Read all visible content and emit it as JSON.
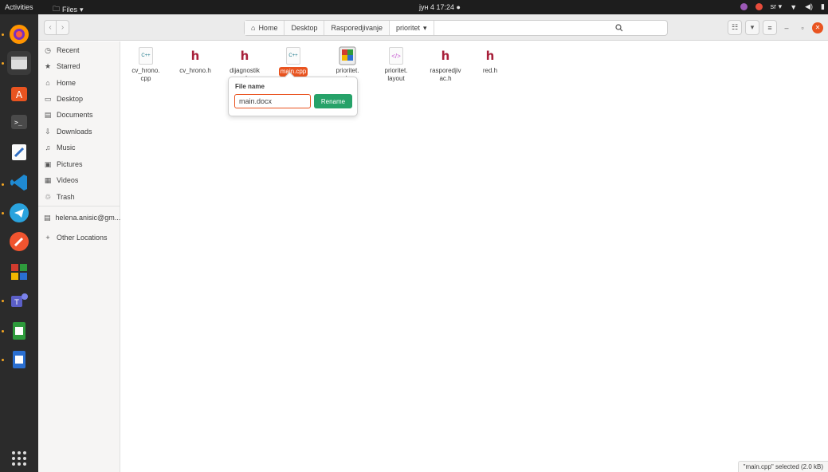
{
  "topbar": {
    "activities": "Activities",
    "app_name": "Files",
    "clock": "јун 4  17:24",
    "lang": "sr"
  },
  "header": {
    "breadcrumbs": [
      "Home",
      "Desktop",
      "Rasporedjivanje",
      "prioritet"
    ]
  },
  "sidebar": {
    "items": [
      {
        "label": "Recent",
        "icon": "clock-icon"
      },
      {
        "label": "Starred",
        "icon": "star-icon"
      },
      {
        "label": "Home",
        "icon": "home-icon"
      },
      {
        "label": "Desktop",
        "icon": "desktop-icon"
      },
      {
        "label": "Documents",
        "icon": "documents-icon"
      },
      {
        "label": "Downloads",
        "icon": "download-icon"
      },
      {
        "label": "Music",
        "icon": "music-icon"
      },
      {
        "label": "Pictures",
        "icon": "pictures-icon"
      },
      {
        "label": "Videos",
        "icon": "videos-icon"
      },
      {
        "label": "Trash",
        "icon": "trash-icon"
      },
      {
        "label": "helena.anisic@gm...",
        "icon": "network-drive-icon"
      },
      {
        "label": "Other Locations",
        "icon": "plus-icon"
      }
    ]
  },
  "files": [
    {
      "name": "cv_hrono.cpp",
      "type": "cpp"
    },
    {
      "name": "cv_hrono.h",
      "type": "h"
    },
    {
      "name": "dijagnostika.h",
      "type": "h"
    },
    {
      "name": "main.cpp",
      "type": "cpp",
      "selected": true
    },
    {
      "name": "prioritet.cbp",
      "type": "cbp"
    },
    {
      "name": "prioritet.layout",
      "type": "layout"
    },
    {
      "name": "rasporedjivac.h",
      "type": "h"
    },
    {
      "name": "red.h",
      "type": "h"
    }
  ],
  "file_labels": {
    "f0": "cv_hrono.\ncpp",
    "f1": "cv_hrono.h",
    "f2": "dijagnostik\na.h",
    "f3": "main.cpp",
    "f4": "prioritet.\ncbp",
    "f5": "prioritet.\nlayout",
    "f6": "rasporedjiv\nac.h",
    "f7": "red.h"
  },
  "icon_text": {
    "cpp": "C++",
    "h": "h",
    "layout": "</>"
  },
  "rename": {
    "label": "File name",
    "value": "main.docx",
    "button": "Rename"
  },
  "status": "\"main.cpp\" selected (2.0 kB)",
  "colors": {
    "accent": "#e95420",
    "rename_button": "#26a269",
    "header_icon": "#a8203a"
  }
}
